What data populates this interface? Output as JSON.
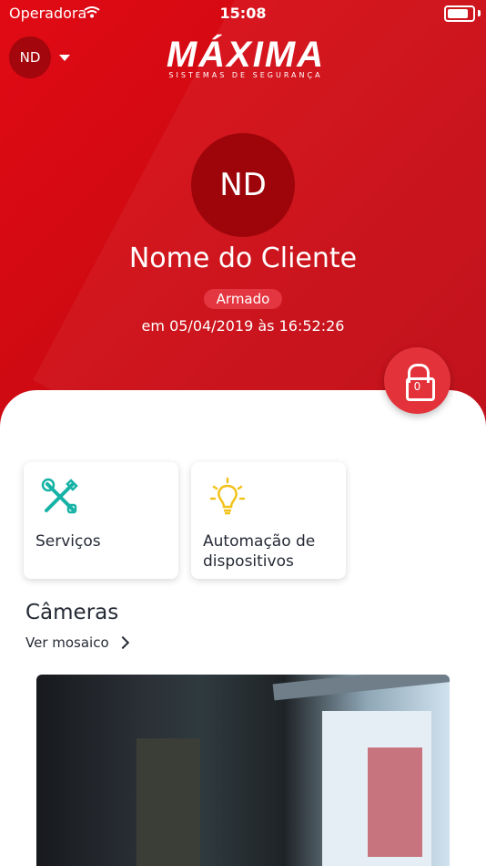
{
  "status_bar": {
    "carrier": "Operadora",
    "time": "15:08"
  },
  "header": {
    "user_initials": "ND",
    "logo_main": "MÁXIMA",
    "logo_sub": "SISTEMAS DE SEGURANÇA"
  },
  "profile": {
    "initials": "ND",
    "name": "Nome do Cliente",
    "status": "Armado",
    "timestamp": "em 05/04/2019 às 16:52:26"
  },
  "lock_button": {
    "count": "0"
  },
  "tiles": [
    {
      "label": "Serviços",
      "icon": "tools-icon"
    },
    {
      "label": "Automação de dispositivos",
      "icon": "lightbulb-icon"
    }
  ],
  "cameras": {
    "title": "Câmeras",
    "mosaic_label": "Ver mosaico"
  },
  "colors": {
    "brand_red": "#e10a14",
    "accent_teal": "#16b2a6",
    "accent_yellow": "#f2c21a"
  }
}
